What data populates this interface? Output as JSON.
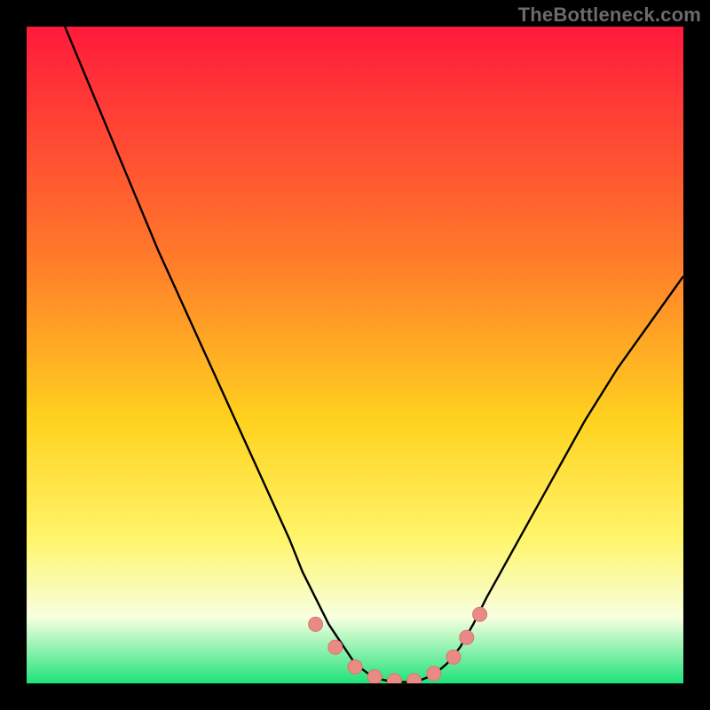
{
  "watermark": "TheBottleneck.com",
  "colors": {
    "background": "#000000",
    "gradient_top": "#ff1a3c",
    "gradient_upper_mid": "#ff7a2a",
    "gradient_mid": "#ffd21f",
    "gradient_lower_mid": "#fff56b",
    "gradient_lower": "#f7ffe0",
    "gradient_bottom": "#1fe37a",
    "curve": "#000000",
    "marker_fill": "#e98b84",
    "marker_stroke": "#d9766f",
    "watermark": "#6b6b6b"
  },
  "chart_data": {
    "type": "line",
    "title": "",
    "xlabel": "",
    "ylabel": "",
    "xlim": [
      0,
      100
    ],
    "ylim": [
      0,
      100
    ],
    "series": [
      {
        "name": "bottleneck-curve",
        "x": [
          0,
          5,
          10,
          15,
          20,
          25,
          30,
          35,
          40,
          42,
          44,
          46,
          48,
          50,
          52,
          54,
          56,
          58,
          60,
          62,
          64,
          66,
          68,
          70,
          75,
          80,
          85,
          90,
          95,
          100
        ],
        "values": [
          114,
          102,
          90,
          78,
          66,
          55,
          44,
          33,
          22,
          17,
          13,
          9,
          6,
          3,
          1.5,
          0.6,
          0.2,
          0.2,
          0.5,
          1.3,
          3,
          5.5,
          9,
          13,
          22,
          31,
          40,
          48,
          55,
          62
        ]
      }
    ],
    "markers": [
      {
        "x": 44,
        "y": 9
      },
      {
        "x": 47,
        "y": 5.5
      },
      {
        "x": 50,
        "y": 2.5
      },
      {
        "x": 53,
        "y": 1
      },
      {
        "x": 56,
        "y": 0.4
      },
      {
        "x": 59,
        "y": 0.4
      },
      {
        "x": 62,
        "y": 1.5
      },
      {
        "x": 65,
        "y": 4
      },
      {
        "x": 67,
        "y": 7
      },
      {
        "x": 69,
        "y": 10.5
      }
    ]
  }
}
